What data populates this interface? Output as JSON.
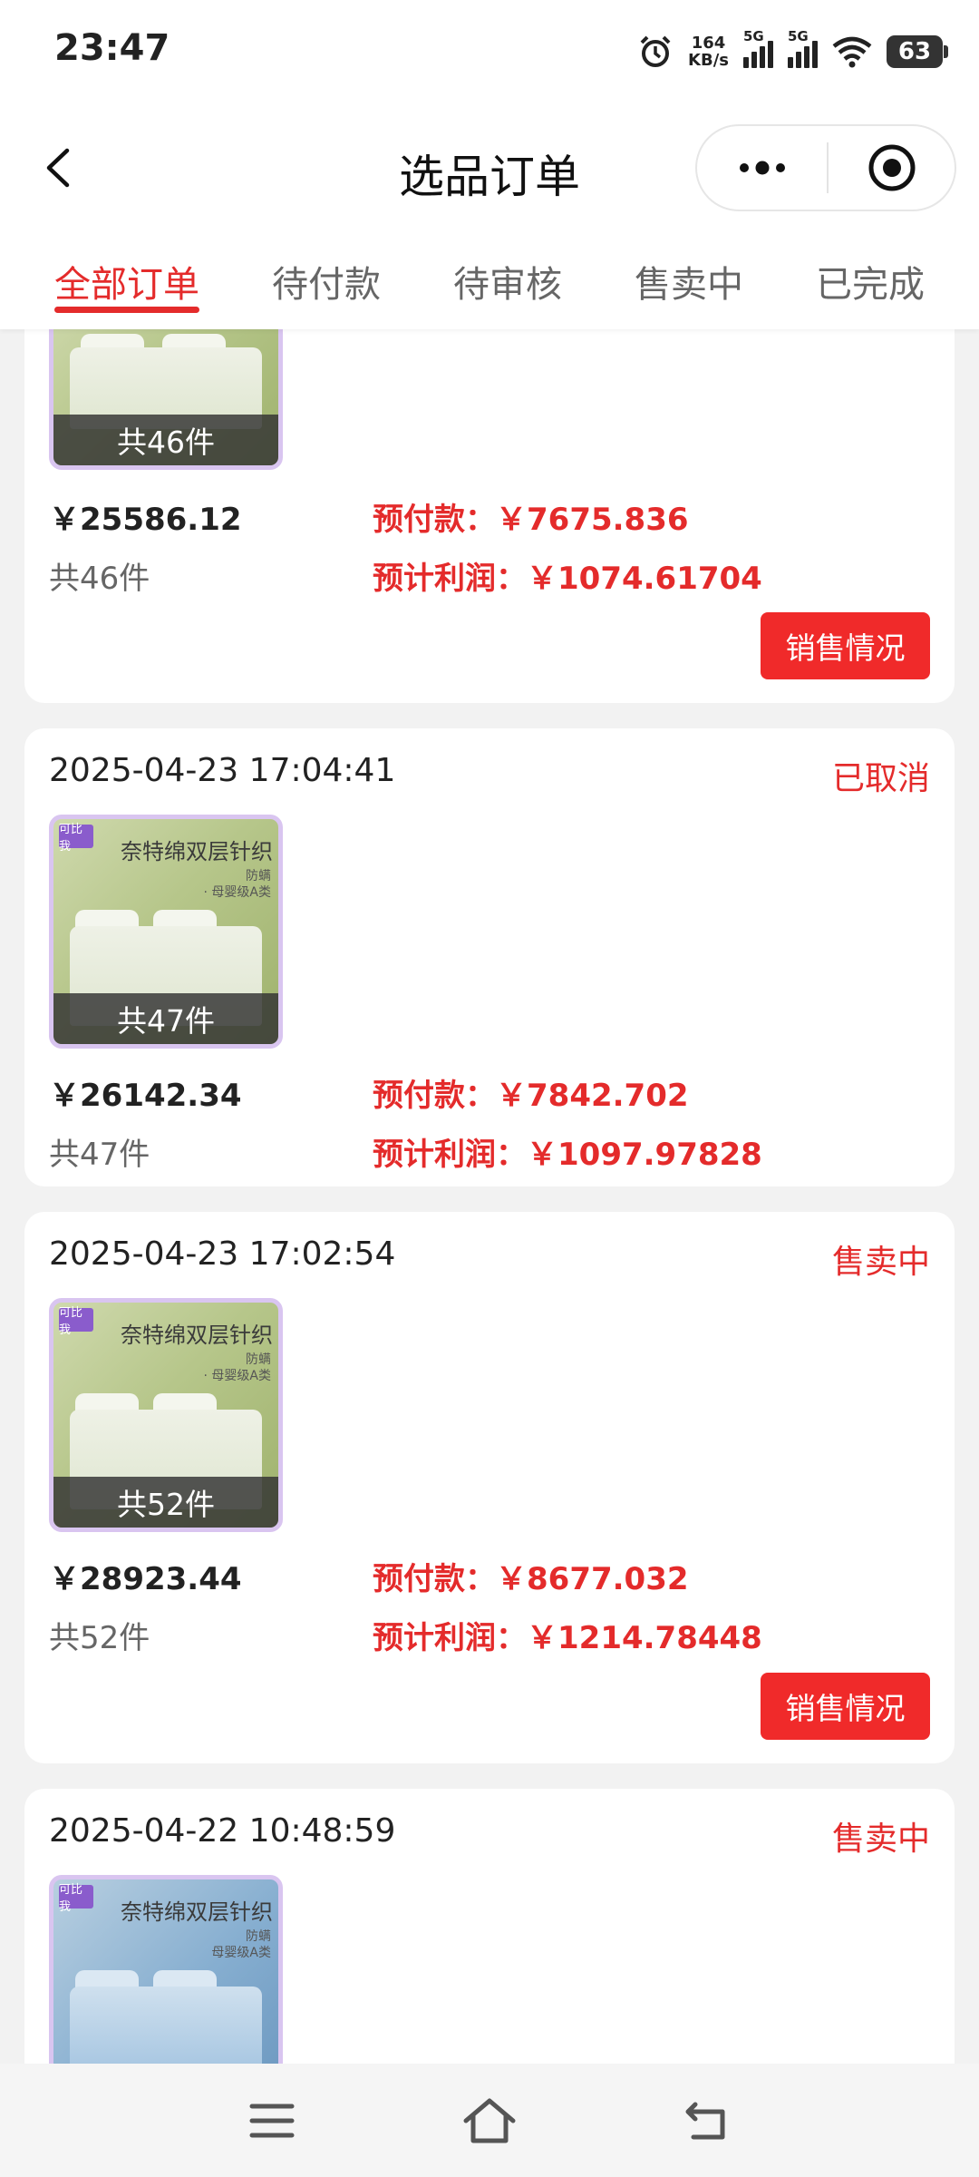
{
  "status_bar": {
    "time": "23:47",
    "net_speed_value": "164",
    "net_speed_unit": "KB/s",
    "sim1_tag": "5G",
    "sim2_tag": "5G",
    "battery": "63"
  },
  "header": {
    "title": "选品订单"
  },
  "tabs": [
    {
      "label": "全部订单",
      "active": true
    },
    {
      "label": "待付款",
      "active": false
    },
    {
      "label": "待审核",
      "active": false
    },
    {
      "label": "售卖中",
      "active": false
    },
    {
      "label": "已完成",
      "active": false
    }
  ],
  "orders": [
    {
      "date": "",
      "status": "",
      "thumb_count": "共46件",
      "price": "￥25586.12",
      "qty": "共46件",
      "prepay": "预付款：￥7675.836",
      "profit": "预计利润：￥1074.61704",
      "button": "销售情况"
    },
    {
      "date": "2025-04-23 17:04:41",
      "status": "已取消",
      "product_title": "奈特绵双层针织",
      "product_sub1": "防螨",
      "product_sub2": "· 母婴级A类",
      "brand_tag": "可比我",
      "thumb_count": "共47件",
      "price": "￥26142.34",
      "qty": "共47件",
      "prepay": "预付款：￥7842.702",
      "profit": "预计利润：￥1097.97828"
    },
    {
      "date": "2025-04-23 17:02:54",
      "status": "售卖中",
      "product_title": "奈特绵双层针织",
      "product_sub1": "防螨",
      "product_sub2": "· 母婴级A类",
      "brand_tag": "可比我",
      "thumb_count": "共52件",
      "price": "￥28923.44",
      "qty": "共52件",
      "prepay": "预付款：￥8677.032",
      "profit": "预计利润：￥1214.78448",
      "button": "销售情况"
    },
    {
      "date": "2025-04-22 10:48:59",
      "status": "售卖中",
      "product_title": "奈特绵双层针织",
      "product_sub1": "防螨",
      "product_sub2": "母婴级A类",
      "brand_tag": "可比我"
    }
  ],
  "colors": {
    "accent": "#e42b2b",
    "button": "#f02a2a",
    "background": "#f2f2f2"
  },
  "icons": {
    "back": "chevron-left-icon",
    "more": "more-dots-icon",
    "close": "target-circle-icon",
    "nav": [
      "menu-icon",
      "home-icon",
      "back-arrow-icon"
    ]
  }
}
